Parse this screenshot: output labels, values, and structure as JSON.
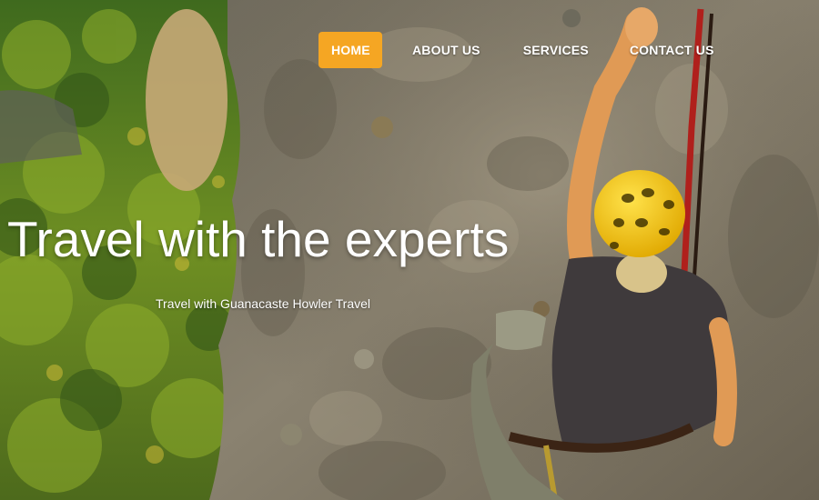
{
  "nav": {
    "items": [
      {
        "label": "HOME",
        "active": true
      },
      {
        "label": "ABOUT US",
        "active": false
      },
      {
        "label": "SERVICES",
        "active": false
      },
      {
        "label": "CONTACT US",
        "active": false
      }
    ],
    "active_color": "#f5a623"
  },
  "hero": {
    "title": "Travel with the experts",
    "subtitle": "Travel with Guanacaste Howler Travel",
    "image_subject": "climber-on-rock-wall-photo"
  }
}
